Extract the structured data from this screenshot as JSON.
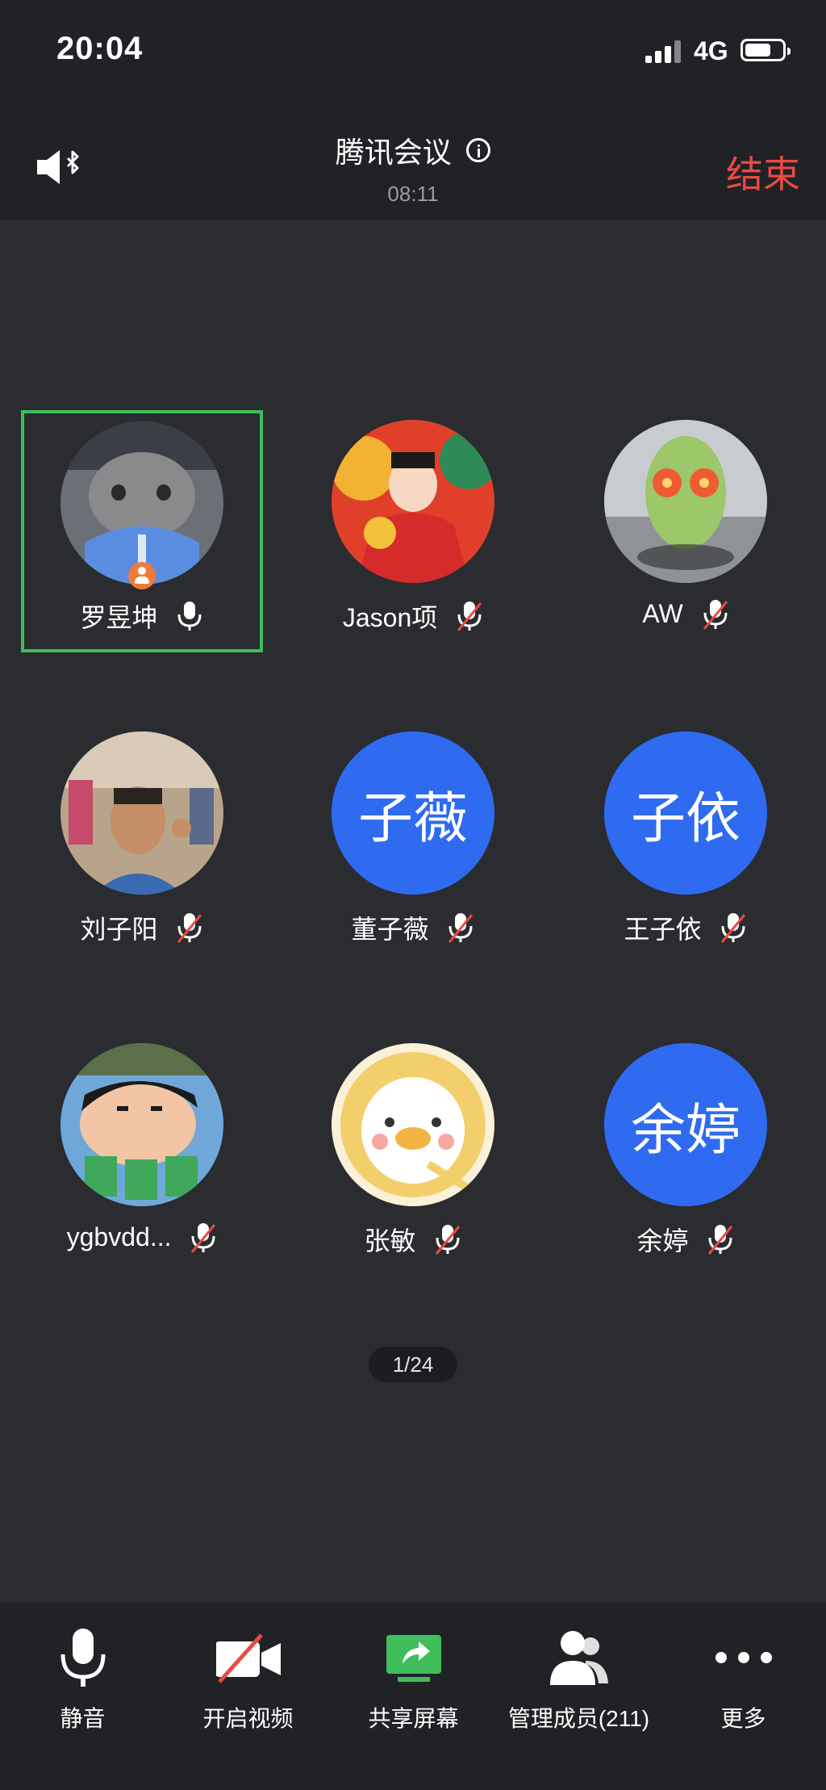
{
  "status_bar": {
    "time": "20:04",
    "network": "4G",
    "battery_level": 0.7
  },
  "header": {
    "title": "腾讯会议",
    "duration": "08:11",
    "end_label": "结束"
  },
  "participants": [
    {
      "name": "罗昱坤",
      "avatar": "photo-cat",
      "mic": "on",
      "host": true,
      "active": true
    },
    {
      "name": "Jason项",
      "avatar": "photo-fortune-child",
      "mic": "muted"
    },
    {
      "name": "AW",
      "avatar": "photo-cartoon-cactus",
      "mic": "muted"
    },
    {
      "name": "刘子阳",
      "avatar": "photo-selfie-street",
      "mic": "muted"
    },
    {
      "name": "董子薇",
      "avatar_text": "子薇",
      "mic": "muted"
    },
    {
      "name": "王子依",
      "avatar_text": "子依",
      "mic": "muted"
    },
    {
      "name": "ygbvdd...",
      "avatar": "photo-cartoon-boy",
      "mic": "muted"
    },
    {
      "name": "张敏",
      "avatar": "photo-cartoon-duck",
      "mic": "muted"
    },
    {
      "name": "余婷",
      "avatar_text": "余婷",
      "mic": "muted"
    }
  ],
  "pagination": "1/24",
  "toolbar": {
    "mute": "静音",
    "video": "开启视频",
    "share": "共享屏幕",
    "members": "管理成员(211)",
    "more": "更多"
  },
  "colors": {
    "accent_green": "#3fbe5b",
    "end_red": "#e94a45",
    "avatar_blue": "#2f6bf0",
    "host_orange": "#f07a3a"
  }
}
